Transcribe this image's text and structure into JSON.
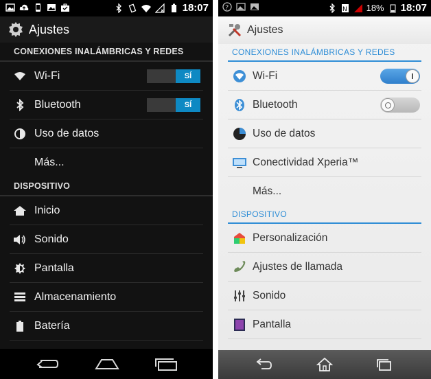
{
  "left": {
    "status": {
      "time": "18:07"
    },
    "actionbar": {
      "title": "Ajustes",
      "icon": "gear-icon"
    },
    "sections": [
      {
        "label": "CONEXIONES INALÁMBRICAS Y REDES",
        "items": [
          {
            "label": "Wi-Fi",
            "icon": "wifi-icon",
            "toggle": "SÍ"
          },
          {
            "label": "Bluetooth",
            "icon": "bluetooth-icon",
            "toggle": "SÍ"
          },
          {
            "label": "Uso de datos",
            "icon": "data-usage-icon"
          },
          {
            "label": "Más...",
            "icon": ""
          }
        ]
      },
      {
        "label": "DISPOSITIVO",
        "items": [
          {
            "label": "Inicio",
            "icon": "home-icon"
          },
          {
            "label": "Sonido",
            "icon": "volume-icon"
          },
          {
            "label": "Pantalla",
            "icon": "brightness-icon"
          },
          {
            "label": "Almacenamiento",
            "icon": "storage-icon"
          },
          {
            "label": "Batería",
            "icon": "battery-icon"
          }
        ]
      }
    ],
    "colors": {
      "accent": "#0e89c3",
      "background": "#121212"
    }
  },
  "right": {
    "status": {
      "battery": "18%",
      "time": "18:07"
    },
    "actionbar": {
      "title": "Ajustes",
      "icon": "tools-icon"
    },
    "sections": [
      {
        "label": "CONEXIONES INALÁMBRICAS Y REDES",
        "items": [
          {
            "label": "Wi-Fi",
            "icon": "wifi-icon",
            "toggle": "on"
          },
          {
            "label": "Bluetooth",
            "icon": "bluetooth-icon",
            "toggle": "off"
          },
          {
            "label": "Uso de datos",
            "icon": "data-usage-icon"
          },
          {
            "label": "Conectividad Xperia™",
            "icon": "xperia-connectivity-icon"
          },
          {
            "label": "Más...",
            "icon": ""
          }
        ]
      },
      {
        "label": "DISPOSITIVO",
        "items": [
          {
            "label": "Personalización",
            "icon": "personalization-icon"
          },
          {
            "label": "Ajustes de llamada",
            "icon": "phone-icon"
          },
          {
            "label": "Sonido",
            "icon": "equalizer-icon"
          },
          {
            "label": "Pantalla",
            "icon": "display-icon"
          }
        ]
      }
    ],
    "colors": {
      "accent": "#2e8dd6",
      "background": "#f0f0f0"
    }
  }
}
